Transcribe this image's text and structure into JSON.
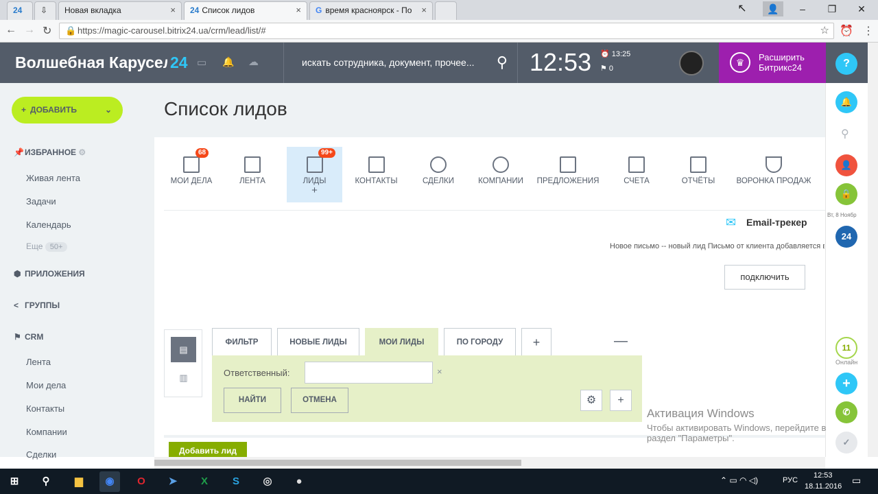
{
  "browser": {
    "tabs": [
      {
        "label": "24"
      },
      {
        "label": ""
      },
      {
        "label": "Новая вкладка"
      },
      {
        "label": "Список лидов",
        "prefix": "24"
      },
      {
        "label": "время красноярск - По"
      }
    ],
    "url": "https://magic-carousel.bitrix24.ua/crm/lead/list/#"
  },
  "header": {
    "logo": "Волшебная Карусел",
    "logo_num": "24",
    "search_placeholder": "искать сотрудника, документ, прочее...",
    "clock": "12:53",
    "alarm_time": "13:25",
    "flag_count": "0",
    "upgrade_line1": "Расширить",
    "upgrade_line2": "Битрикс24",
    "help": "?"
  },
  "sidebar": {
    "add_label": "ДОБАВИТЬ",
    "favorites": "ИЗБРАННОЕ",
    "fav_items": [
      "Живая лента",
      "Задачи",
      "Календарь"
    ],
    "more_label": "Еще",
    "more_count": "50+",
    "apps": "ПРИЛОЖЕНИЯ",
    "groups": "ГРУППЫ",
    "crm": "CRM",
    "crm_items": [
      "Лента",
      "Мои дела",
      "Контакты",
      "Компании",
      "Сделки"
    ]
  },
  "page": {
    "title": "Список лидов",
    "crm_menu": [
      {
        "label": "МОИ ДЕЛА",
        "badge": "68"
      },
      {
        "label": "ЛЕНТА"
      },
      {
        "label": "ЛИДЫ",
        "badge": "99+"
      },
      {
        "label": "КОНТАКТЫ"
      },
      {
        "label": "СДЕЛКИ"
      },
      {
        "label": "КОМПАНИИ"
      },
      {
        "label": "ПРЕДЛОЖЕНИЯ"
      },
      {
        "label": "СЧЕТА"
      },
      {
        "label": "ОТЧЁТЫ"
      },
      {
        "label": "ВОРОНКА ПРОДАЖ"
      }
    ],
    "email_title": "Email-трекер",
    "email_text": "Новое письмо -- новый лид Письмо от клиента добавляется в список лидов",
    "connect_label": "подключить",
    "filter_tabs": [
      "ФИЛЬТР",
      "НОВЫЕ ЛИДЫ",
      "МОИ ЛИДЫ",
      "ПО ГОРОДУ"
    ],
    "filter_field_label": "Ответственный:",
    "filter_field_value": "",
    "find_label": "НАЙТИ",
    "cancel_label": "ОТМЕНА",
    "add_lead_label": "Добавить лид"
  },
  "rail": {
    "date_label": "Вт, 8 Ноябр",
    "online_count": "11",
    "online_label": "Онлайн"
  },
  "watermark": {
    "line1": "Активация Windows",
    "line2": "Чтобы активировать Windows, перейдите в",
    "line3": "раздел \"Параметры\"."
  },
  "taskbar": {
    "lang": "РУС",
    "time": "12:53",
    "date": "18.11.2016"
  },
  "colors": {
    "header": "#535c69",
    "accent_green": "#bbed21",
    "upgrade_purple": "#9d1fae",
    "badge_red": "#f54819"
  }
}
